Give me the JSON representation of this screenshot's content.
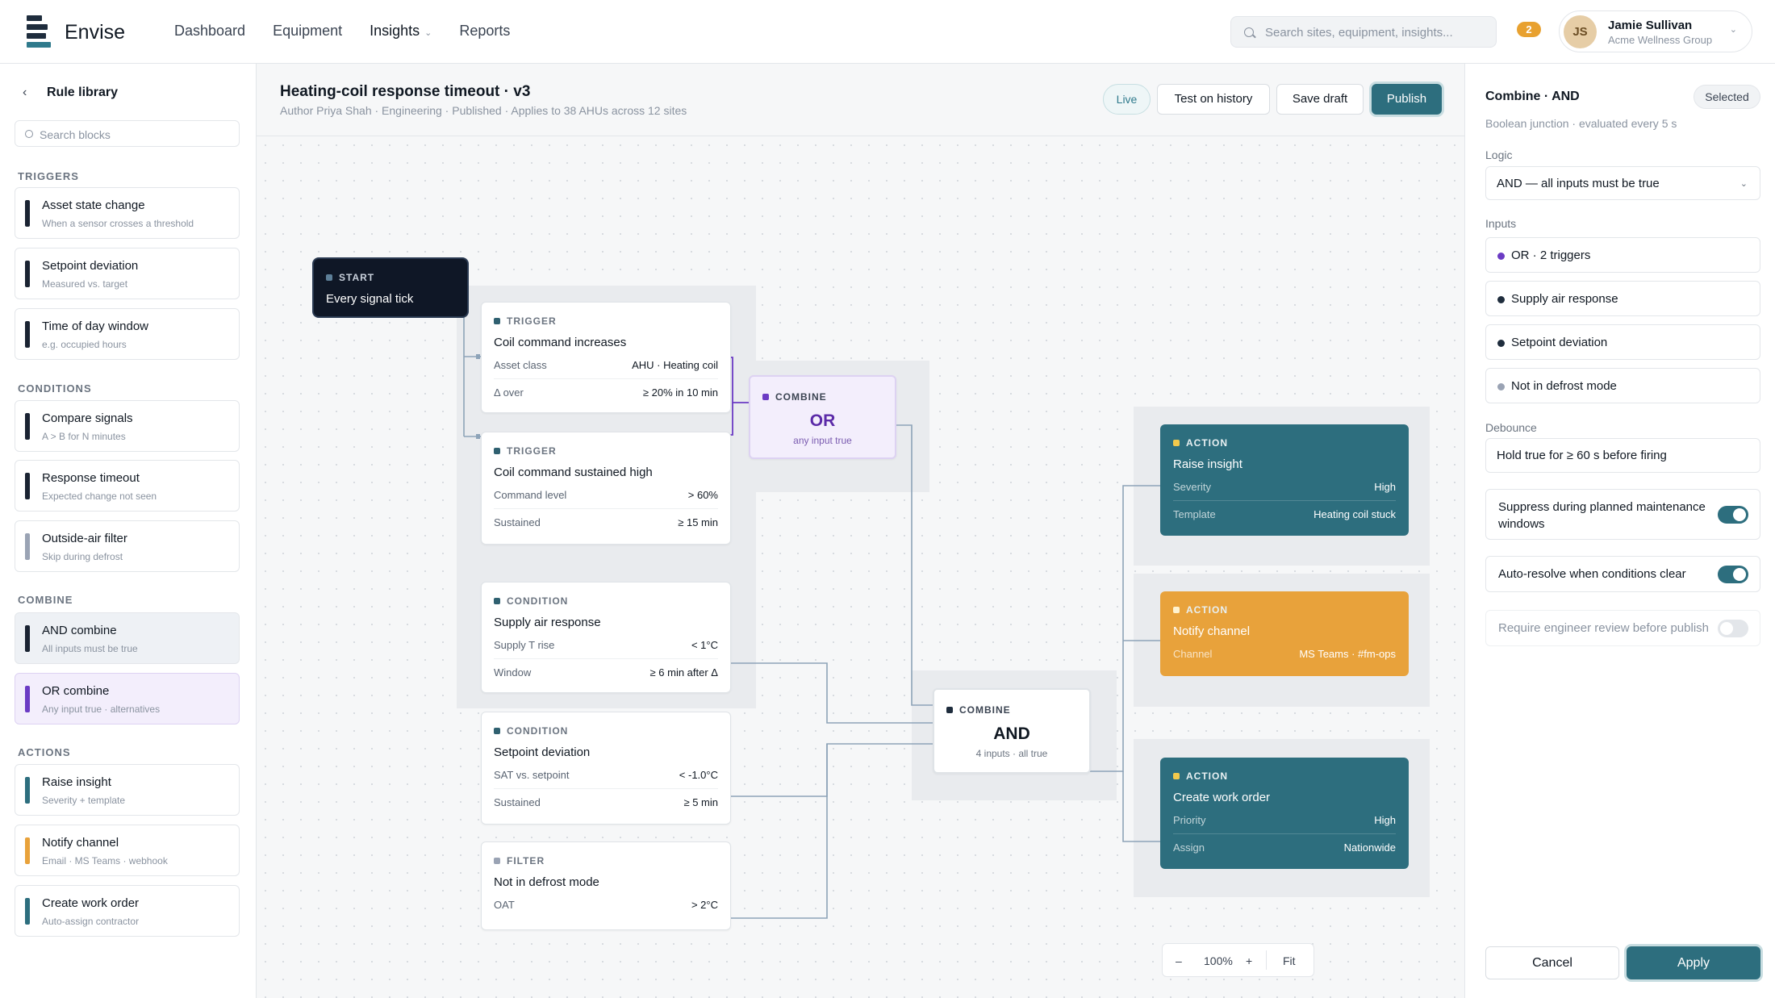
{
  "app": {
    "brand": "Envise"
  },
  "nav": {
    "items": [
      "Dashboard",
      "Equipment",
      "Insights",
      "Reports"
    ],
    "active": "Insights"
  },
  "search": {
    "placeholder": "Search sites, equipment, insights..."
  },
  "notifications": {
    "count": "2"
  },
  "user": {
    "initials": "JS",
    "name": "Jamie Sullivan",
    "org": "Acme Wellness Group"
  },
  "sidebar": {
    "title": "Rule library",
    "search_placeholder": "Search blocks",
    "sections": [
      {
        "label": "TRIGGERS",
        "blocks": [
          {
            "title": "Asset state change",
            "sub": "When a sensor crosses a threshold"
          },
          {
            "title": "Setpoint deviation",
            "sub": "Measured vs. target"
          },
          {
            "title": "Time of day window",
            "sub": "e.g. occupied hours"
          }
        ]
      },
      {
        "label": "CONDITIONS",
        "blocks": [
          {
            "title": "Compare signals",
            "sub": "A > B for N minutes"
          },
          {
            "title": "Response timeout",
            "sub": "Expected change not seen"
          },
          {
            "title": "Outside-air filter",
            "sub": "Skip during defrost"
          }
        ]
      },
      {
        "label": "COMBINE",
        "blocks": [
          {
            "title": "AND combine",
            "sub": "All inputs must be true"
          },
          {
            "title": "OR combine",
            "sub": "Any input true · alternatives"
          }
        ]
      },
      {
        "label": "ACTIONS",
        "blocks": [
          {
            "title": "Raise insight",
            "sub": "Severity + template"
          },
          {
            "title": "Notify channel",
            "sub": "Email · MS Teams · webhook"
          },
          {
            "title": "Create work order",
            "sub": "Auto-assign contractor"
          }
        ]
      }
    ]
  },
  "rule": {
    "title": "Heating-coil response timeout · v3",
    "meta": "Author Priya Shah · Engineering · Published · Applies to 38 AHUs across 12 sites",
    "status": "Live",
    "buttons": {
      "test": "Test on history",
      "save": "Save draft",
      "publish": "Publish"
    }
  },
  "canvas": {
    "start": {
      "kind": "START",
      "name": "Every signal tick"
    },
    "trigger1": {
      "kind": "TRIGGER",
      "name": "Coil command increases",
      "rows": [
        {
          "k": "Asset class",
          "v": "AHU · Heating coil"
        },
        {
          "k": "Δ over",
          "v": "≥ 20% in 10 min"
        }
      ]
    },
    "trigger2": {
      "kind": "TRIGGER",
      "name": "Coil command sustained high",
      "rows": [
        {
          "k": "Command level",
          "v": "> 60%"
        },
        {
          "k": "Sustained",
          "v": "≥ 15 min"
        }
      ]
    },
    "cond1": {
      "kind": "CONDITION",
      "name": "Supply air response",
      "rows": [
        {
          "k": "Supply T rise",
          "v": "< 1°C"
        },
        {
          "k": "Window",
          "v": "≥ 6 min after Δ"
        }
      ]
    },
    "cond2": {
      "kind": "CONDITION",
      "name": "Setpoint deviation",
      "rows": [
        {
          "k": "SAT vs. setpoint",
          "v": "< -1.0°C"
        },
        {
          "k": "Sustained",
          "v": "≥ 5 min"
        }
      ]
    },
    "filter": {
      "kind": "FILTER",
      "name": "Not in defrost mode",
      "rows": [
        {
          "k": "OAT",
          "v": "> 2°C"
        }
      ]
    },
    "or": {
      "kind": "COMBINE",
      "big": "OR",
      "sub": "any input true"
    },
    "and": {
      "kind": "COMBINE",
      "big": "AND",
      "sub": "4 inputs · all true"
    },
    "action1": {
      "kind": "ACTION",
      "name": "Raise insight",
      "rows": [
        {
          "k": "Severity",
          "v": "High"
        },
        {
          "k": "Template",
          "v": "Heating coil stuck"
        }
      ]
    },
    "action2": {
      "kind": "ACTION",
      "name": "Notify channel",
      "rows": [
        {
          "k": "Channel",
          "v": "MS Teams · #fm-ops"
        }
      ]
    },
    "action3": {
      "kind": "ACTION",
      "name": "Create work order",
      "rows": [
        {
          "k": "Priority",
          "v": "High"
        },
        {
          "k": "Assign",
          "v": "Nationwide"
        }
      ]
    },
    "zoom": {
      "minus": "–",
      "level": "100%",
      "plus": "+",
      "fit": "Fit"
    }
  },
  "panel": {
    "title": "Combine · AND",
    "badge": "Selected",
    "sub": "Boolean junction · evaluated every 5 s",
    "logic_label": "Logic",
    "logic_value": "AND — all inputs must be true",
    "inputs_label": "Inputs",
    "inputs": [
      "OR · 2 triggers",
      "Supply air response",
      "Setpoint deviation",
      "Not in defrost mode"
    ],
    "debounce_label": "Debounce",
    "debounce_value": "Hold true for ≥ 60 s before firing",
    "toggles": [
      {
        "label": "Suppress during planned maintenance windows",
        "on": true
      },
      {
        "label": "Auto-resolve when conditions clear",
        "on": true
      },
      {
        "label": "Require engineer review before publish",
        "on": false
      }
    ],
    "cancel": "Cancel",
    "apply": "Apply"
  },
  "colors": {
    "accent": "#2d6e7e",
    "or_purple": "#5b2aa8",
    "amber": "#e8a23b",
    "navy": "#0f1726"
  }
}
